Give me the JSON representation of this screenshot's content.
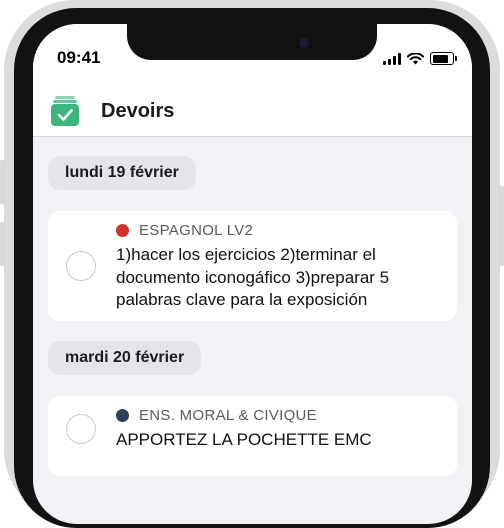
{
  "status_bar": {
    "time": "09:41",
    "battery_level": 0.9
  },
  "app": {
    "title": "Devoirs",
    "icon": "homework-checkbox-icon",
    "icon_color": "#3db57d"
  },
  "days": [
    {
      "label": "lundi 19 février",
      "tasks": [
        {
          "subject": "ESPAGNOL LV2",
          "subject_color": "#d0332b",
          "text": "1)hacer los ejercicios 2)terminar el documento iconogáfico 3)preparar 5 palabras clave para la exposición",
          "done": false
        }
      ]
    },
    {
      "label": "mardi 20 février",
      "tasks": [
        {
          "subject": "ENS. MORAL & CIVIQUE",
          "subject_color": "#2e4257",
          "text": "APPORTEZ LA POCHETTE EMC",
          "done": false
        }
      ]
    }
  ]
}
